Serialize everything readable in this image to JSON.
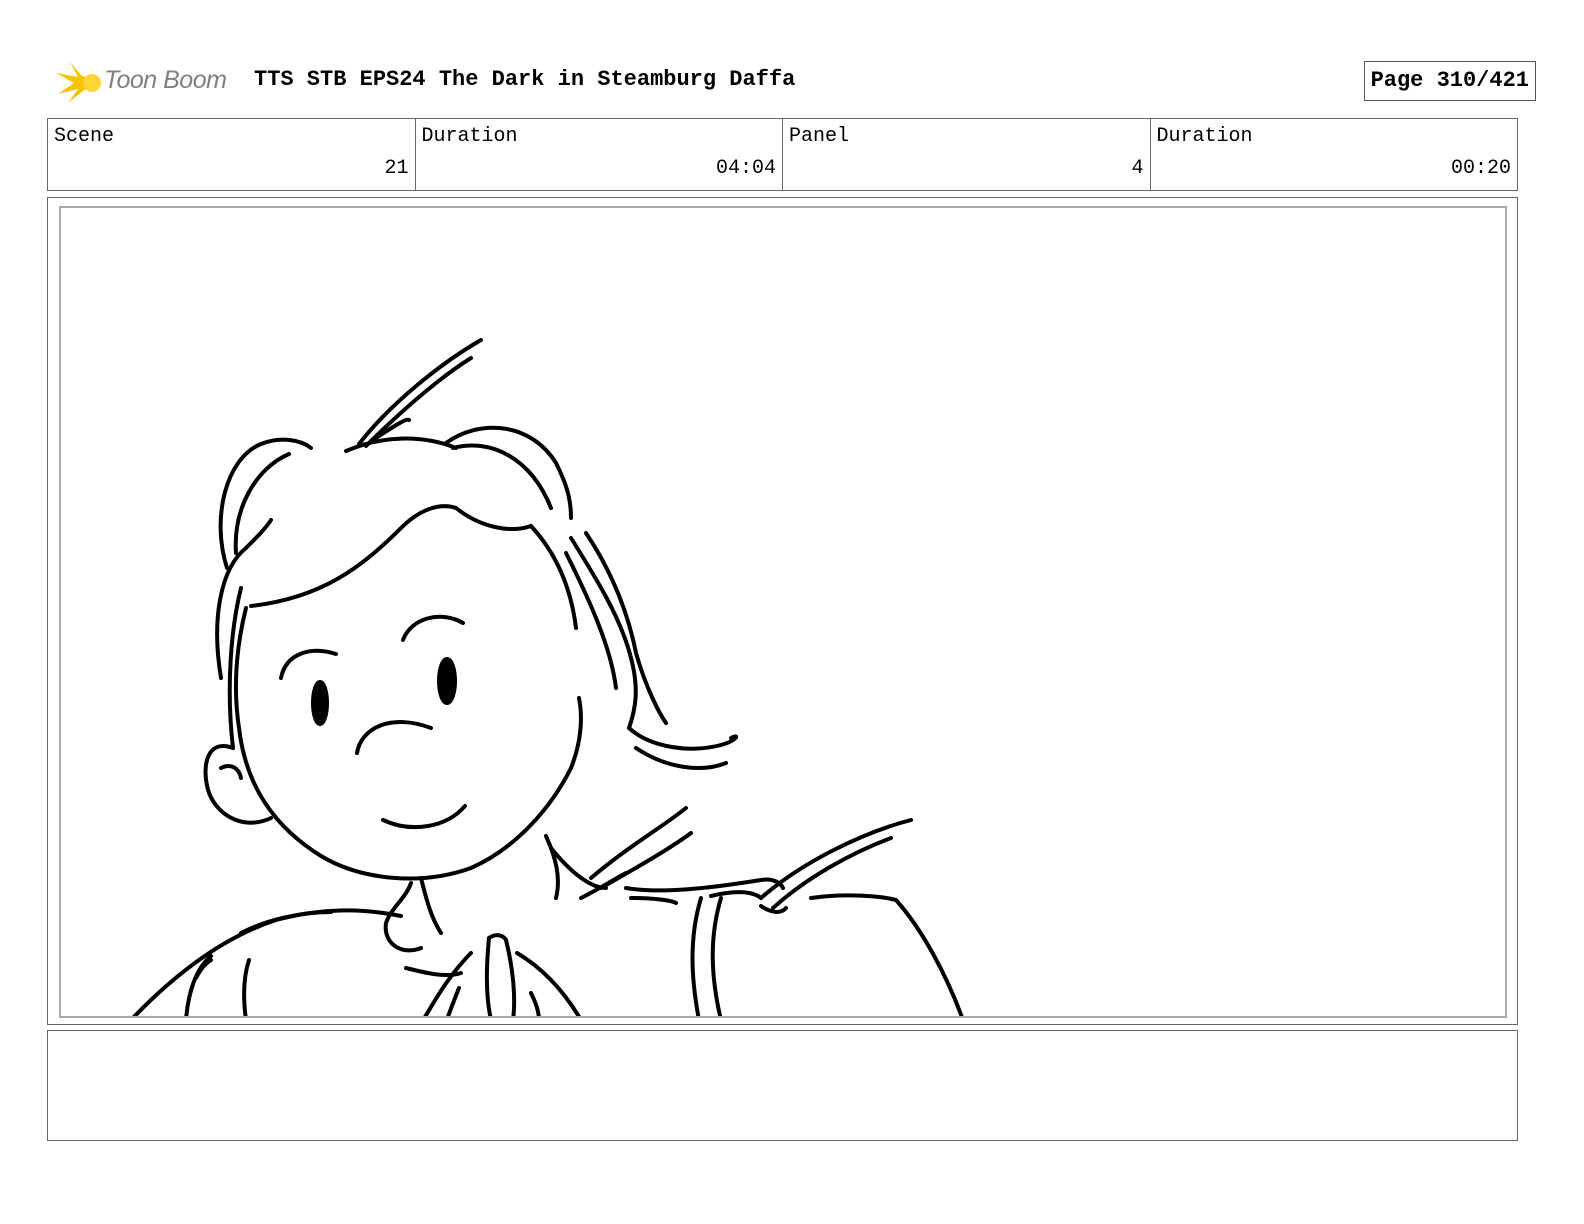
{
  "header": {
    "logo_text": "Toon Boom",
    "title": "TTS STB EPS24 The Dark in Steamburg Daffa",
    "page_label": "Page 310/421"
  },
  "info": [
    {
      "label": "Scene",
      "value": "21"
    },
    {
      "label": "Duration",
      "value": "04:04"
    },
    {
      "label": "Panel",
      "value": "4"
    },
    {
      "label": "Duration",
      "value": "00:20"
    }
  ],
  "colors": {
    "logo_star": "#f5c400",
    "logo_text": "#808080"
  },
  "panel": {
    "image": "storyboard-sketch-character-closeup"
  },
  "notes": ""
}
